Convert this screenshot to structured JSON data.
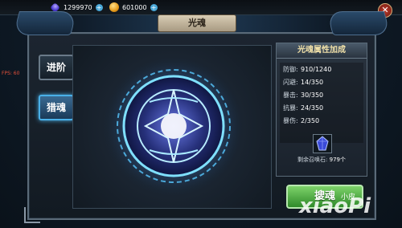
{
  "resources": {
    "gem": "1299970",
    "gold": "601000"
  },
  "header": {
    "title": "光魂"
  },
  "tabs": {
    "advance": "进阶",
    "hunt": "猎魂"
  },
  "fps": "FPS: 60",
  "attributes": {
    "title": "光魂属性加成",
    "rows": [
      {
        "name": "防御",
        "value": "910/1240"
      },
      {
        "name": "闪避",
        "value": "14/350"
      },
      {
        "name": "暴击",
        "value": "30/350"
      },
      {
        "name": "抗暴",
        "value": "24/350"
      },
      {
        "name": "暴伤",
        "value": "2/350"
      }
    ],
    "stone_label": "剩余召唤石:",
    "stone_count": "979个"
  },
  "action": {
    "label": "搜魂",
    "sub": "小皮"
  },
  "watermark": "xiaoPi",
  "colors": {
    "accent": "#4ab0e8",
    "action_green": "#4caf3a",
    "title_gold": "#f0e0a8"
  }
}
